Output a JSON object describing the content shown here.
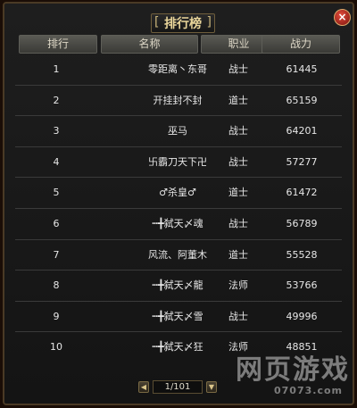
{
  "title": "排行榜",
  "close_icon": "×",
  "columns": [
    "排行",
    "名称",
    "职业",
    "战力"
  ],
  "rows": [
    {
      "rank": "1",
      "name": "零距离丶东哥",
      "job": "战士",
      "power": "61445"
    },
    {
      "rank": "2",
      "name": "开挂封不封",
      "job": "道士",
      "power": "65159"
    },
    {
      "rank": "3",
      "name": "巫马",
      "job": "战士",
      "power": "64201"
    },
    {
      "rank": "4",
      "name": "卐霸刀天下卍",
      "job": "战士",
      "power": "57277"
    },
    {
      "rank": "5",
      "name": "♂杀皇♂",
      "job": "道士",
      "power": "61472"
    },
    {
      "rank": "6",
      "name": "┅╋弑天〆魂",
      "job": "战士",
      "power": "56789"
    },
    {
      "rank": "7",
      "name": "风流、阿董木",
      "job": "道士",
      "power": "55528"
    },
    {
      "rank": "8",
      "name": "┅╋弑天〆龍",
      "job": "法师",
      "power": "53766"
    },
    {
      "rank": "9",
      "name": "┅╋弑天〆雪",
      "job": "战士",
      "power": "49996"
    },
    {
      "rank": "10",
      "name": "┅╋弑天〆狂",
      "job": "法师",
      "power": "48851"
    }
  ],
  "pager": {
    "prev_icon": "◀",
    "page_info": "1/101",
    "next_icon": "▼"
  },
  "watermark": {
    "text": "网页游戏",
    "sub": "07073.com"
  }
}
